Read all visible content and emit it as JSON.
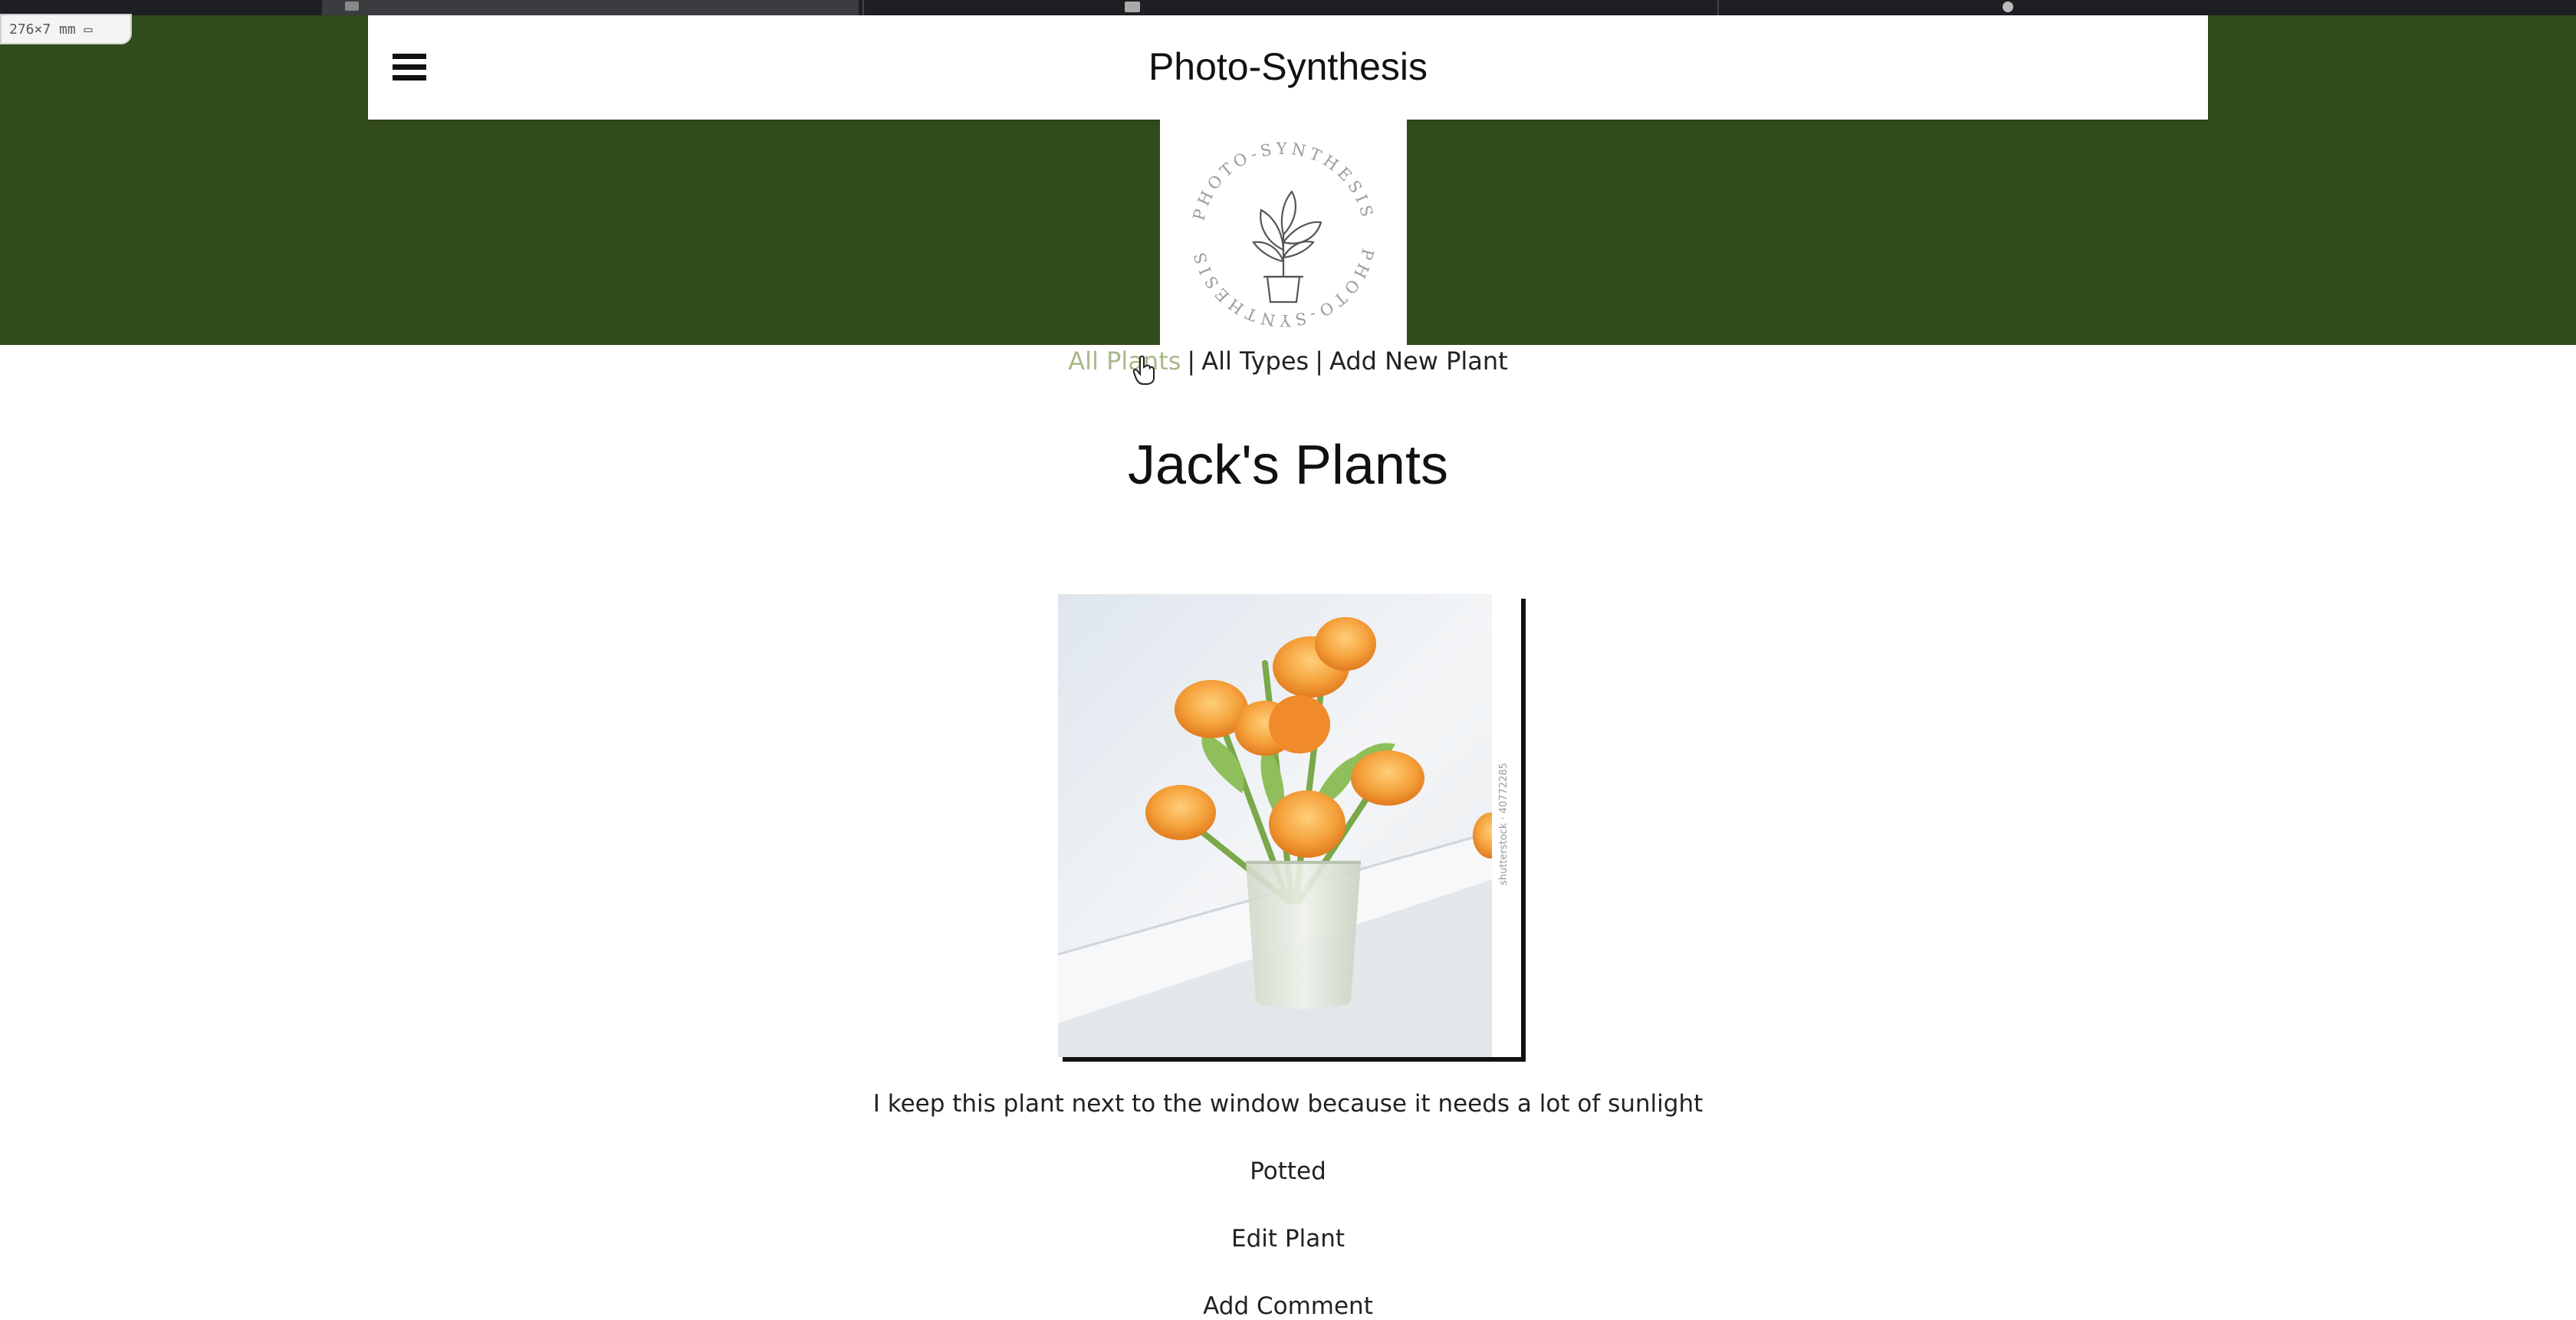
{
  "browser": {
    "size_badge": "276×7 mm ▭"
  },
  "header": {
    "menu_icon": "hamburger-icon",
    "site_title": "Photo-Synthesis",
    "logo_text": "PHOTO-SYNTHESIS"
  },
  "nav": {
    "links": [
      "All Plants",
      "All Types",
      "Add New Plant"
    ],
    "separator": "|",
    "active": "All Plants"
  },
  "colors": {
    "hero_green": "#324b1a",
    "active_link": "#a8b888"
  },
  "main": {
    "heading": "Jack's Plants",
    "photo_alt": "Orange tulips in a glass vase by a window",
    "photo_watermark": "shutterstock · 40772285",
    "description": "I keep this plant next to the window because it needs a lot of sunlight",
    "type": "Potted",
    "edit_label": "Edit Plant",
    "comment_label": "Add Comment"
  }
}
